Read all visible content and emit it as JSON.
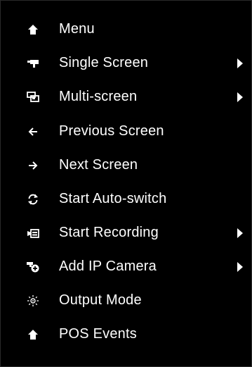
{
  "menu": {
    "items": [
      {
        "label": "Menu",
        "icon": "home-icon",
        "has_submenu": false
      },
      {
        "label": "Single Screen",
        "icon": "camera-icon",
        "has_submenu": true
      },
      {
        "label": "Multi-screen",
        "icon": "multi-screen-icon",
        "has_submenu": true
      },
      {
        "label": "Previous Screen",
        "icon": "arrow-left-icon",
        "has_submenu": false
      },
      {
        "label": "Next Screen",
        "icon": "arrow-right-icon",
        "has_submenu": false
      },
      {
        "label": "Start Auto-switch",
        "icon": "refresh-icon",
        "has_submenu": false
      },
      {
        "label": "Start Recording",
        "icon": "record-icon",
        "has_submenu": true
      },
      {
        "label": "Add IP Camera",
        "icon": "add-camera-icon",
        "has_submenu": true
      },
      {
        "label": "Output Mode",
        "icon": "sun-icon",
        "has_submenu": false
      },
      {
        "label": "POS Events",
        "icon": "home-icon",
        "has_submenu": false
      }
    ]
  },
  "colors": {
    "background": "#000000",
    "text": "#ffffff"
  }
}
